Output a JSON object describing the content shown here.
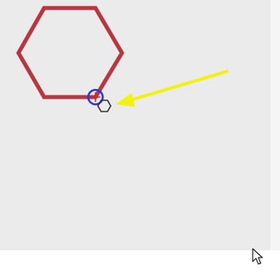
{
  "app": {
    "canvas_background": "#ebebec",
    "bottom_background": "#ffffff"
  },
  "shapes": {
    "hexagon": {
      "kind": "regular-hexagon",
      "stroke_color": "#b8363f",
      "fill": "none"
    },
    "snap_marker": {
      "kind": "vertex-snap-indicator",
      "ring_color": "#2b38d6",
      "cross_color": "#c02a2a"
    },
    "polygon_tool_cursor": {
      "icon": "hexagon-tool-icon",
      "color": "#333333"
    }
  },
  "annotation": {
    "arrow": {
      "icon": "arrow-left-icon",
      "color": "#f3f20a"
    }
  },
  "cursor": {
    "icon": "mouse-pointer-icon",
    "color": "#ffffff",
    "outline": "#222222"
  }
}
